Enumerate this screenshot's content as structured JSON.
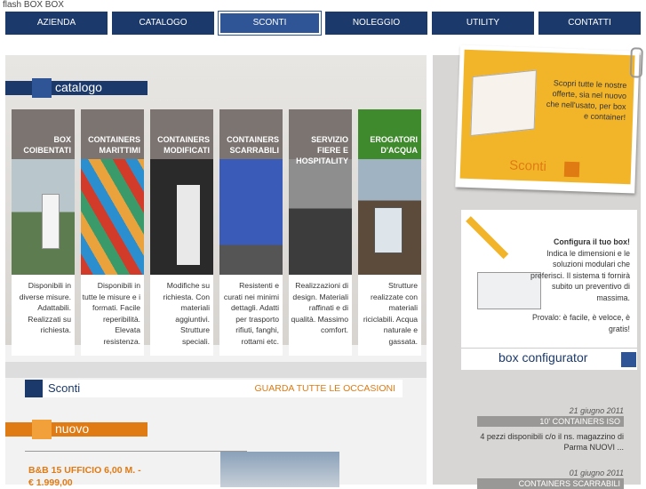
{
  "window_title": "flash BOX BOX",
  "nav": {
    "items": [
      {
        "label": "AZIENDA"
      },
      {
        "label": "CATALOGO"
      },
      {
        "label": "SCONTI"
      },
      {
        "label": "NOLEGGIO"
      },
      {
        "label": "UTILITY"
      },
      {
        "label": "CONTATTI"
      }
    ],
    "active": "SCONTI"
  },
  "catalogo": {
    "heading": "catalogo",
    "tiles": [
      {
        "title": "BOX COIBENTATI",
        "desc": "Disponibili in diverse misure. Adattabili. Realizzati su richiesta."
      },
      {
        "title": "CONTAINERS MARITTIMI",
        "desc": "Disponibili in tutte le misure e i formati. Facile reperibilità. Elevata resistenza."
      },
      {
        "title": "CONTAINERS MODIFICATI",
        "desc": "Modifiche su richiesta. Con materiali aggiuntivi. Strutture speciali."
      },
      {
        "title": "CONTAINERS SCARRABILI",
        "desc": "Resistenti e curati nei minimi dettagli. Adatti per trasporto rifiuti, fanghi, rottami etc."
      },
      {
        "title": "SERVIZIO FIERE E HOSPITALITY",
        "desc": "Realizzazioni di design. Materiali raffinati e di qualità. Massimo comfort."
      },
      {
        "title": "EROGATORI D'ACQUA",
        "desc": "Strutture realizzate con materiali riciclabili. Acqua naturale e gassata."
      }
    ]
  },
  "sconti": {
    "heading": "Sconti",
    "link": "GUARDA TUTTE LE OCCASIONI"
  },
  "nuovo": {
    "heading": "nuovo",
    "product_title": "B&B 15 UFFICIO 6,00 M. - € 1.999,00"
  },
  "promo_sconti": {
    "text": "Scopri tutte le nostre offerte, sia nel nuovo che nell'usato, per box e container!",
    "label": "Sconti"
  },
  "configurator": {
    "title": "Configura il tuo box!",
    "text": "Indica le dimensioni e le soluzioni modulari che preferisci. Il sistema ti fornirà subito un preventivo di massima.",
    "cta": "Provalo: è facile, è veloce, è gratis!",
    "label": "box configurator"
  },
  "news": [
    {
      "date": "21 giugno 2011",
      "title": "10' CONTAINERS ISO",
      "body": "4 pezzi disponibili c/o il ns. magazzino di Parma NUOVI ..."
    },
    {
      "date": "01 giugno 2011",
      "title": "CONTAINERS SCARRABILI",
      "body": ""
    }
  ],
  "colors": {
    "nav_bg": "#1b3a6b",
    "accent_blue": "#2f5596",
    "accent_orange": "#e07a13",
    "promo_yellow": "#f2b52a",
    "green_tile": "#3f8a2c"
  }
}
